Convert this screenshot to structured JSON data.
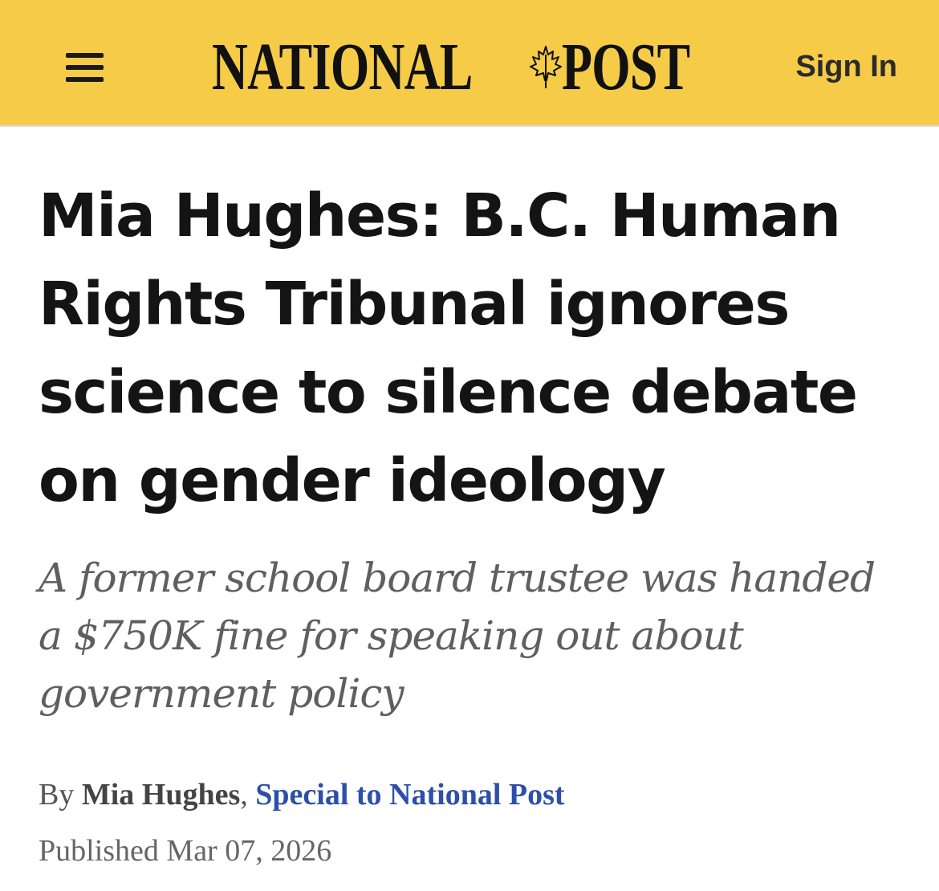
{
  "header": {
    "menu_icon": "hamburger-menu-icon",
    "logo": {
      "word1": "NATIONAL",
      "word2": "POST",
      "emblem_icon": "maple-leaf-icon"
    },
    "sign_in_label": "Sign In",
    "background_color": "#f5cb48"
  },
  "article": {
    "headline": "Mia Hughes: B.C. Human Rights Tribunal ignores science to silence debate on gender ideology",
    "subhead": "A former school board trustee was handed a $750K fine for speaking out about government policy",
    "byline": {
      "prefix": "By",
      "author": "Mia Hughes",
      "separator": ",",
      "affiliation": "Special to National Post"
    },
    "published": {
      "label": "Published",
      "date": "Mar 07, 2026"
    }
  },
  "colors": {
    "accent_yellow": "#f5cb48",
    "link_blue": "#2d4fa8",
    "headline_text": "#141414"
  }
}
